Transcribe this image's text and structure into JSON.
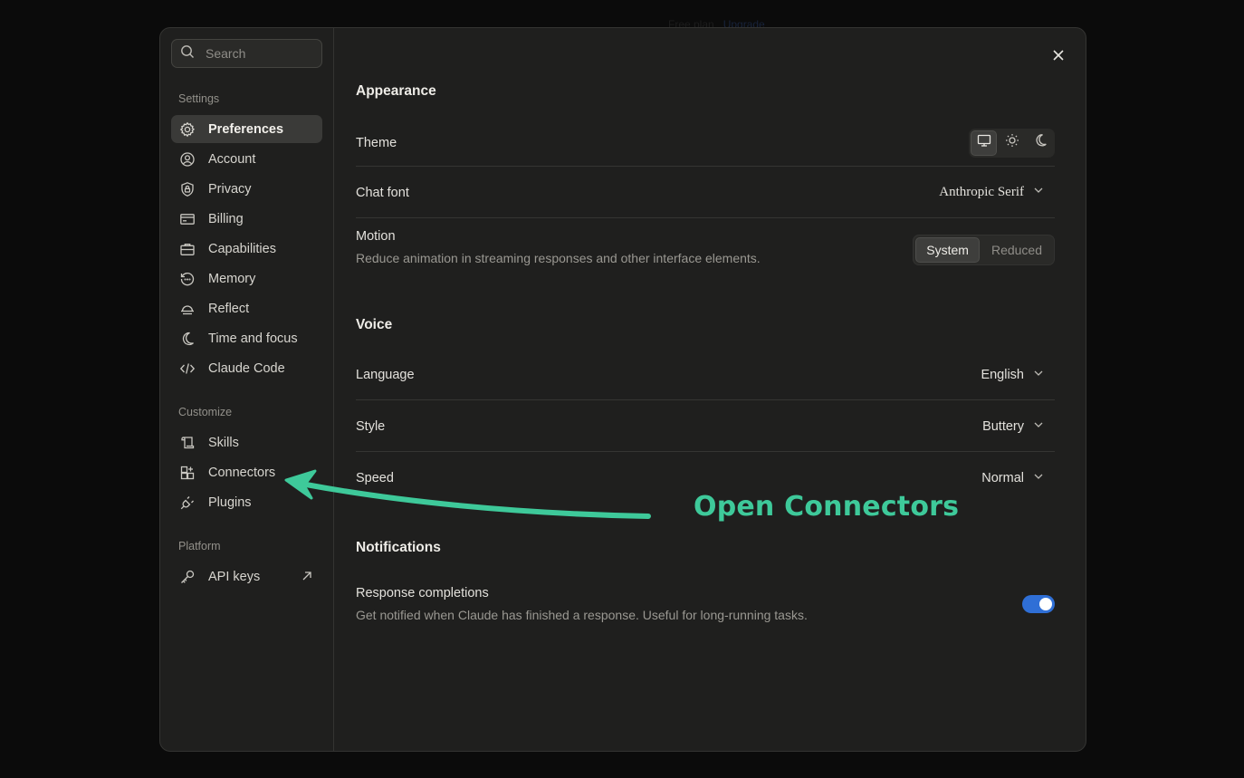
{
  "background": {
    "plan_text": "Free plan",
    "upgrade_link": "Upgrade"
  },
  "search": {
    "placeholder": "Search"
  },
  "sidebar": {
    "settings_label": "Settings",
    "settings_items": [
      {
        "label": "Preferences",
        "icon": "gear-icon",
        "active": true
      },
      {
        "label": "Account",
        "icon": "user-circle-icon"
      },
      {
        "label": "Privacy",
        "icon": "shield-lock-icon"
      },
      {
        "label": "Billing",
        "icon": "credit-card-icon"
      },
      {
        "label": "Capabilities",
        "icon": "briefcase-icon"
      },
      {
        "label": "Memory",
        "icon": "history-icon"
      },
      {
        "label": "Reflect",
        "icon": "sunset-icon"
      },
      {
        "label": "Time and focus",
        "icon": "moon-icon"
      },
      {
        "label": "Claude Code",
        "icon": "code-icon"
      }
    ],
    "customize_label": "Customize",
    "customize_items": [
      {
        "label": "Skills",
        "icon": "scroll-icon"
      },
      {
        "label": "Connectors",
        "icon": "grid-plus-icon"
      },
      {
        "label": "Plugins",
        "icon": "plug-icon"
      }
    ],
    "platform_label": "Platform",
    "platform_items": [
      {
        "label": "API keys",
        "icon": "key-icon",
        "external": true
      }
    ]
  },
  "appearance": {
    "title": "Appearance",
    "theme_label": "Theme",
    "theme_options": [
      "monitor-icon",
      "sun-icon",
      "moon-icon"
    ],
    "theme_selected": "monitor-icon",
    "chat_font_label": "Chat font",
    "chat_font_value": "Anthropic Serif",
    "motion_label": "Motion",
    "motion_desc": "Reduce animation in streaming responses and other interface elements.",
    "motion_options": [
      "System",
      "Reduced"
    ],
    "motion_selected": "System"
  },
  "voice": {
    "title": "Voice",
    "language_label": "Language",
    "language_value": "English",
    "style_label": "Style",
    "style_value": "Buttery",
    "speed_label": "Speed",
    "speed_value": "Normal"
  },
  "notifications": {
    "title": "Notifications",
    "response_label": "Response completions",
    "response_desc": "Get notified when Claude has finished a response. Useful for long-running tasks.",
    "response_enabled": true
  },
  "annotation": {
    "text": "Open Connectors",
    "color": "#3ec99a"
  },
  "colors": {
    "toggle_on": "#2f6fd6",
    "modal_bg": "#1f1f1e",
    "page_bg": "#0b0b0b"
  }
}
